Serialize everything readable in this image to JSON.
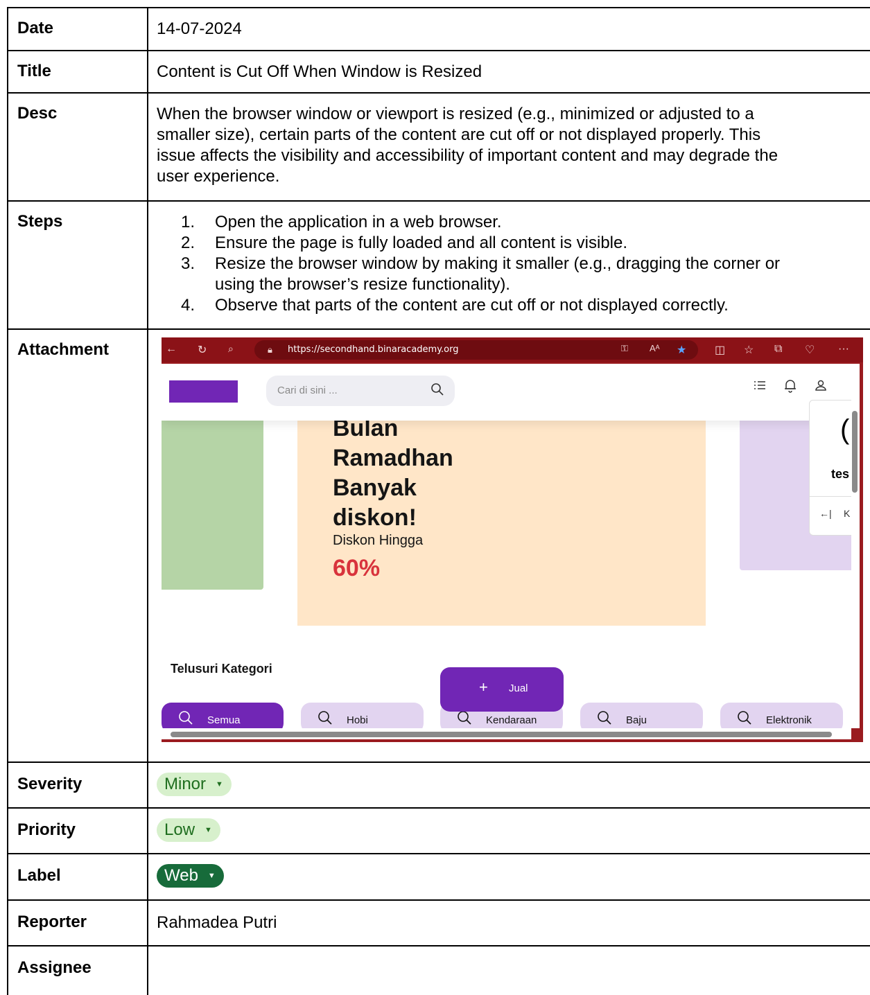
{
  "report": {
    "date": {
      "label": "Date",
      "value": "14-07-2024"
    },
    "title": {
      "label": "Title",
      "value": "Content is Cut Off When Window is Resized"
    },
    "desc": {
      "label": "Desc",
      "lines": [
        "When the browser window or viewport is resized (e.g., minimized or adjusted to a",
        "smaller size), certain parts of the content are cut off or not displayed properly. This",
        "issue affects the visibility and accessibility of important content and may degrade the",
        "user experience."
      ]
    },
    "steps": {
      "label": "Steps",
      "items": [
        "Open the application in a web browser.",
        "Ensure the page is fully loaded and all content is visible.",
        "Resize the browser window by making it smaller (e.g., dragging the corner or",
        "Observe that parts of the content are cut off or not displayed correctly."
      ],
      "item3_continuation": "using the browser’s resize functionality)."
    },
    "attachment": {
      "label": "Attachment"
    },
    "severity": {
      "label": "Severity",
      "value": "Minor",
      "color": "#d7f0cc"
    },
    "priority": {
      "label": "Priority",
      "value": "Low",
      "color": "#d7f0cc"
    },
    "tag": {
      "label": "Label",
      "value": "Web",
      "color": "#176b3a"
    },
    "reporter": {
      "label": "Reporter",
      "value": "Rahmadea Putri"
    },
    "assignee": {
      "label": "Assignee",
      "value": ""
    }
  },
  "screenshot": {
    "url": "https://secondhand.binaracademy.org",
    "search_placeholder": "Cari di sini ...",
    "promo_heading_lines": [
      "Bulan",
      "Ramadhan",
      "Banyak",
      "diskon!"
    ],
    "promo_sub": "Diskon Hingga",
    "promo_pct": "60%",
    "popup_text": "tes",
    "popup_paren": "(",
    "popup_nav": "←|",
    "popup_k": "K",
    "categories_title": "Telusuri Kategori",
    "sell_button": "Jual",
    "categories": [
      "Semua",
      "Hobi",
      "Kendaraan",
      "Baju",
      "Elektronik"
    ],
    "brand_color": "#7126b5",
    "accent_red": "#d8333c",
    "browser_frame_color": "#8b1217"
  }
}
